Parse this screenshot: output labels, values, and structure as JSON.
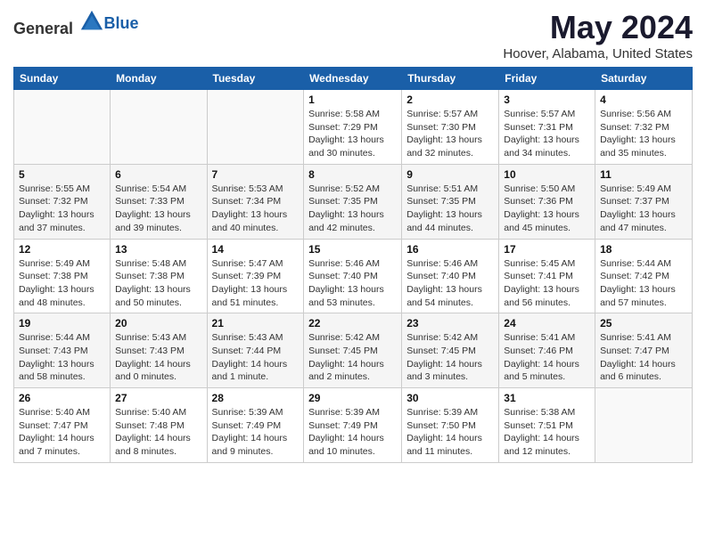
{
  "logo": {
    "general": "General",
    "blue": "Blue"
  },
  "header": {
    "month_year": "May 2024",
    "location": "Hoover, Alabama, United States"
  },
  "weekdays": [
    "Sunday",
    "Monday",
    "Tuesday",
    "Wednesday",
    "Thursday",
    "Friday",
    "Saturday"
  ],
  "weeks": [
    {
      "days": [
        {
          "num": "",
          "sunrise": "",
          "sunset": "",
          "daylight": ""
        },
        {
          "num": "",
          "sunrise": "",
          "sunset": "",
          "daylight": ""
        },
        {
          "num": "",
          "sunrise": "",
          "sunset": "",
          "daylight": ""
        },
        {
          "num": "1",
          "sunrise": "Sunrise: 5:58 AM",
          "sunset": "Sunset: 7:29 PM",
          "daylight": "Daylight: 13 hours and 30 minutes."
        },
        {
          "num": "2",
          "sunrise": "Sunrise: 5:57 AM",
          "sunset": "Sunset: 7:30 PM",
          "daylight": "Daylight: 13 hours and 32 minutes."
        },
        {
          "num": "3",
          "sunrise": "Sunrise: 5:57 AM",
          "sunset": "Sunset: 7:31 PM",
          "daylight": "Daylight: 13 hours and 34 minutes."
        },
        {
          "num": "4",
          "sunrise": "Sunrise: 5:56 AM",
          "sunset": "Sunset: 7:32 PM",
          "daylight": "Daylight: 13 hours and 35 minutes."
        }
      ]
    },
    {
      "days": [
        {
          "num": "5",
          "sunrise": "Sunrise: 5:55 AM",
          "sunset": "Sunset: 7:32 PM",
          "daylight": "Daylight: 13 hours and 37 minutes."
        },
        {
          "num": "6",
          "sunrise": "Sunrise: 5:54 AM",
          "sunset": "Sunset: 7:33 PM",
          "daylight": "Daylight: 13 hours and 39 minutes."
        },
        {
          "num": "7",
          "sunrise": "Sunrise: 5:53 AM",
          "sunset": "Sunset: 7:34 PM",
          "daylight": "Daylight: 13 hours and 40 minutes."
        },
        {
          "num": "8",
          "sunrise": "Sunrise: 5:52 AM",
          "sunset": "Sunset: 7:35 PM",
          "daylight": "Daylight: 13 hours and 42 minutes."
        },
        {
          "num": "9",
          "sunrise": "Sunrise: 5:51 AM",
          "sunset": "Sunset: 7:35 PM",
          "daylight": "Daylight: 13 hours and 44 minutes."
        },
        {
          "num": "10",
          "sunrise": "Sunrise: 5:50 AM",
          "sunset": "Sunset: 7:36 PM",
          "daylight": "Daylight: 13 hours and 45 minutes."
        },
        {
          "num": "11",
          "sunrise": "Sunrise: 5:49 AM",
          "sunset": "Sunset: 7:37 PM",
          "daylight": "Daylight: 13 hours and 47 minutes."
        }
      ]
    },
    {
      "days": [
        {
          "num": "12",
          "sunrise": "Sunrise: 5:49 AM",
          "sunset": "Sunset: 7:38 PM",
          "daylight": "Daylight: 13 hours and 48 minutes."
        },
        {
          "num": "13",
          "sunrise": "Sunrise: 5:48 AM",
          "sunset": "Sunset: 7:38 PM",
          "daylight": "Daylight: 13 hours and 50 minutes."
        },
        {
          "num": "14",
          "sunrise": "Sunrise: 5:47 AM",
          "sunset": "Sunset: 7:39 PM",
          "daylight": "Daylight: 13 hours and 51 minutes."
        },
        {
          "num": "15",
          "sunrise": "Sunrise: 5:46 AM",
          "sunset": "Sunset: 7:40 PM",
          "daylight": "Daylight: 13 hours and 53 minutes."
        },
        {
          "num": "16",
          "sunrise": "Sunrise: 5:46 AM",
          "sunset": "Sunset: 7:40 PM",
          "daylight": "Daylight: 13 hours and 54 minutes."
        },
        {
          "num": "17",
          "sunrise": "Sunrise: 5:45 AM",
          "sunset": "Sunset: 7:41 PM",
          "daylight": "Daylight: 13 hours and 56 minutes."
        },
        {
          "num": "18",
          "sunrise": "Sunrise: 5:44 AM",
          "sunset": "Sunset: 7:42 PM",
          "daylight": "Daylight: 13 hours and 57 minutes."
        }
      ]
    },
    {
      "days": [
        {
          "num": "19",
          "sunrise": "Sunrise: 5:44 AM",
          "sunset": "Sunset: 7:43 PM",
          "daylight": "Daylight: 13 hours and 58 minutes."
        },
        {
          "num": "20",
          "sunrise": "Sunrise: 5:43 AM",
          "sunset": "Sunset: 7:43 PM",
          "daylight": "Daylight: 14 hours and 0 minutes."
        },
        {
          "num": "21",
          "sunrise": "Sunrise: 5:43 AM",
          "sunset": "Sunset: 7:44 PM",
          "daylight": "Daylight: 14 hours and 1 minute."
        },
        {
          "num": "22",
          "sunrise": "Sunrise: 5:42 AM",
          "sunset": "Sunset: 7:45 PM",
          "daylight": "Daylight: 14 hours and 2 minutes."
        },
        {
          "num": "23",
          "sunrise": "Sunrise: 5:42 AM",
          "sunset": "Sunset: 7:45 PM",
          "daylight": "Daylight: 14 hours and 3 minutes."
        },
        {
          "num": "24",
          "sunrise": "Sunrise: 5:41 AM",
          "sunset": "Sunset: 7:46 PM",
          "daylight": "Daylight: 14 hours and 5 minutes."
        },
        {
          "num": "25",
          "sunrise": "Sunrise: 5:41 AM",
          "sunset": "Sunset: 7:47 PM",
          "daylight": "Daylight: 14 hours and 6 minutes."
        }
      ]
    },
    {
      "days": [
        {
          "num": "26",
          "sunrise": "Sunrise: 5:40 AM",
          "sunset": "Sunset: 7:47 PM",
          "daylight": "Daylight: 14 hours and 7 minutes."
        },
        {
          "num": "27",
          "sunrise": "Sunrise: 5:40 AM",
          "sunset": "Sunset: 7:48 PM",
          "daylight": "Daylight: 14 hours and 8 minutes."
        },
        {
          "num": "28",
          "sunrise": "Sunrise: 5:39 AM",
          "sunset": "Sunset: 7:49 PM",
          "daylight": "Daylight: 14 hours and 9 minutes."
        },
        {
          "num": "29",
          "sunrise": "Sunrise: 5:39 AM",
          "sunset": "Sunset: 7:49 PM",
          "daylight": "Daylight: 14 hours and 10 minutes."
        },
        {
          "num": "30",
          "sunrise": "Sunrise: 5:39 AM",
          "sunset": "Sunset: 7:50 PM",
          "daylight": "Daylight: 14 hours and 11 minutes."
        },
        {
          "num": "31",
          "sunrise": "Sunrise: 5:38 AM",
          "sunset": "Sunset: 7:51 PM",
          "daylight": "Daylight: 14 hours and 12 minutes."
        },
        {
          "num": "",
          "sunrise": "",
          "sunset": "",
          "daylight": ""
        }
      ]
    }
  ]
}
